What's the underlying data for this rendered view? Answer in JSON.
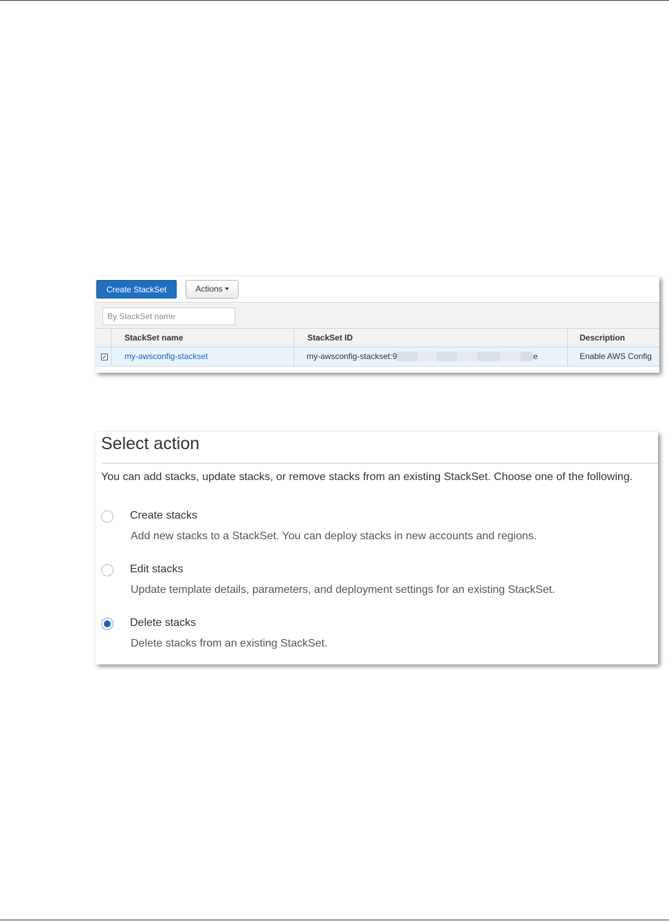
{
  "stackset_list": {
    "create_button": "Create StackSet",
    "actions_button": "Actions",
    "filter_placeholder": "By StackSet name",
    "columns": [
      "StackSet name",
      "StackSet ID",
      "Description"
    ],
    "rows": [
      {
        "selected": true,
        "name": "my-awsconfig-stackset",
        "id_prefix": "my-awsconfig-stackset:9",
        "id_suffix": "e",
        "description": "Enable AWS Config"
      }
    ]
  },
  "select_action": {
    "title": "Select action",
    "intro": "You can add stacks, update stacks, or remove stacks from an existing StackSet. Choose one of the following.",
    "options": [
      {
        "label": "Create stacks",
        "description": "Add new stacks to a StackSet. You can deploy stacks in new accounts and regions.",
        "selected": false
      },
      {
        "label": "Edit stacks",
        "description": "Update template details, parameters, and deployment settings for an existing StackSet.",
        "selected": false
      },
      {
        "label": "Delete stacks",
        "description": "Delete stacks from an existing StackSet.",
        "selected": true
      }
    ]
  },
  "colors": {
    "primary_button": "#1f6fc2",
    "link": "#1a62b5",
    "selected_row": "#e9f3fc",
    "radio_selected": "#1565c0"
  }
}
